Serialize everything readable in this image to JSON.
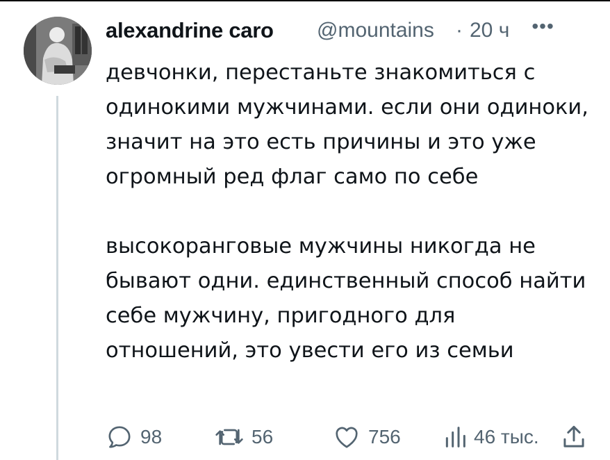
{
  "tweet": {
    "author_name": "alexandrine caro",
    "handle": "@mountains",
    "separator": "·",
    "time": "20 ч",
    "more_icon": "more-horizontal-icon",
    "paragraphs": [
      "девчонки, перестаньте знакомиться с одинокими мужчинами. если они одиноки, значит на это есть причины и это уже огромный ред флаг само по себе",
      "высокоранговые мужчины никогда не бывают одни. единственный способ найти себе мужчину, пригодного для отношений, это увести его из семьи"
    ]
  },
  "actions": {
    "replies": "98",
    "reposts": "56",
    "likes": "756",
    "views": "46 тыс.",
    "icons": [
      "reply-icon",
      "repost-icon",
      "like-icon",
      "views-icon",
      "share-icon"
    ]
  },
  "colors": {
    "text": "#0f1419",
    "secondary": "#536471",
    "thread_line": "#cfd9de"
  }
}
